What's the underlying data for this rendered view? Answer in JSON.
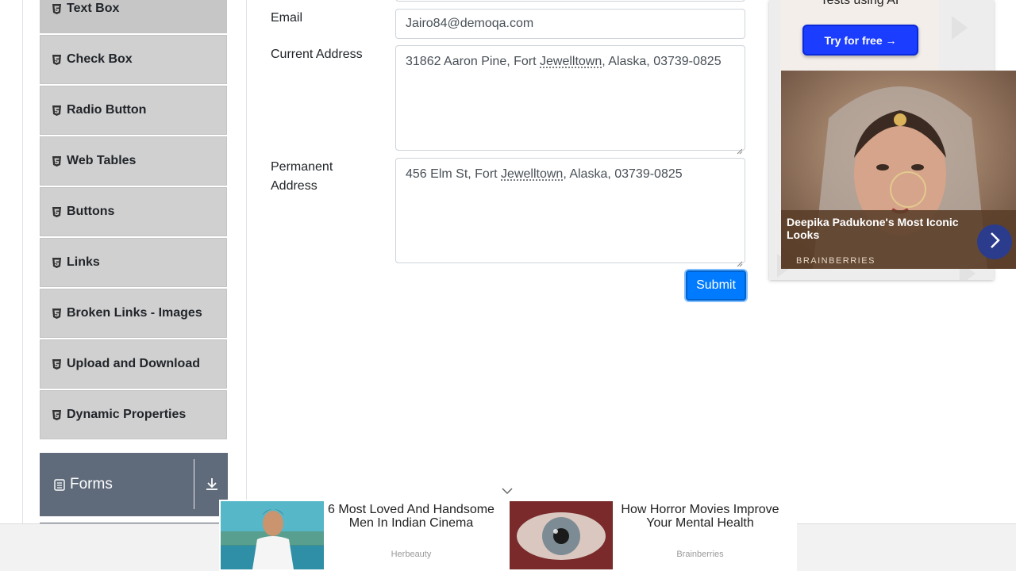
{
  "sidebar": {
    "items": [
      {
        "label": "Text Box"
      },
      {
        "label": "Check Box"
      },
      {
        "label": "Radio Button"
      },
      {
        "label": "Web Tables"
      },
      {
        "label": "Buttons"
      },
      {
        "label": "Links"
      },
      {
        "label": "Broken Links - Images"
      },
      {
        "label": "Upload and Download"
      },
      {
        "label": "Dynamic Properties"
      }
    ],
    "group": {
      "label": "Forms"
    }
  },
  "form": {
    "email": {
      "label": "Email",
      "value": "Jairo84@demoqa.com"
    },
    "current_address": {
      "label": "Current Address",
      "pre": "31862 Aaron Pine, Fort ",
      "underlined": "Jewelltown",
      "post": ", Alaska, 03739-0825"
    },
    "permanent_address": {
      "label_line1": "Permanent",
      "label_line2": "Address",
      "pre": "456 Elm St, Fort ",
      "underlined": "Jewelltown",
      "post": ", Alaska, 03739-0825"
    },
    "submit_label": "Submit"
  },
  "right_ad": {
    "top_text": "Tests using AI",
    "button_label": "Try for free →",
    "caption_title": "Deepika Padukone's Most Iconic Looks",
    "caption_brand": "BRAINBERRIES"
  },
  "bottom_ad": {
    "cards": [
      {
        "title": "6 Most Loved And Handsome Men In Indian Cinema",
        "source": "Herbeauty"
      },
      {
        "title": "How Horror Movies Improve Your Mental Health",
        "source": "Brainberries"
      }
    ]
  },
  "colors": {
    "accent": "#007bff",
    "sidebar_item_bg": "#d0d0d0",
    "group_header_bg": "#5f6b7a"
  }
}
